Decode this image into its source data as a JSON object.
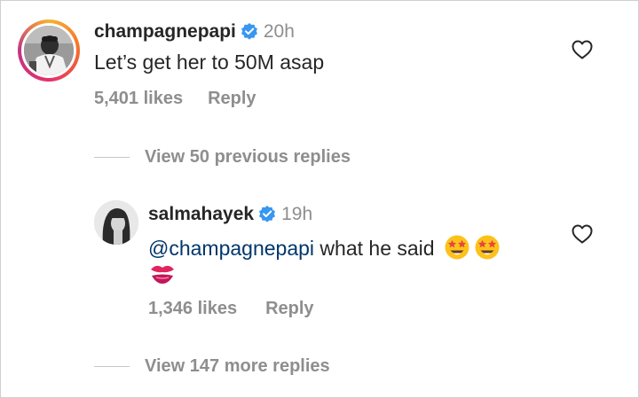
{
  "comment": {
    "username": "champagnepapi",
    "time": "20h",
    "text": "Let’s get her to 50M asap",
    "likes": "5,401 likes",
    "reply_label": "Reply"
  },
  "view_previous": "View 50 previous replies",
  "reply": {
    "username": "salmahayek",
    "time": "19h",
    "mention": "@champagnepapi",
    "text": " what he said",
    "likes": "1,346 likes",
    "reply_label": "Reply"
  },
  "view_more": "View 147 more replies",
  "icons": {
    "verified": "verified-badge-icon",
    "like": "heart-outline-icon",
    "emoji_1": "star-struck-emoji",
    "emoji_2": "kiss-mark-emoji"
  },
  "colors": {
    "verified_blue": "#3897f0",
    "mention_blue": "#00376b",
    "muted_gray": "#8e8e8e",
    "text": "#262626"
  }
}
